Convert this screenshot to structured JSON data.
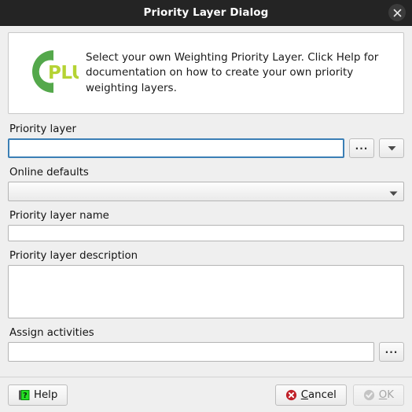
{
  "window": {
    "title": "Priority Layer Dialog",
    "close_icon": "close-icon"
  },
  "info": {
    "logo_icon": "cplus-logo-icon",
    "logo_text": "PLUS",
    "message": "Select your own Weighting Priority Layer. Click Help for documentation on how to create your own priority weighting layers.",
    "logo_color_c": "#4da css",
    "colors": {
      "logo_ring": "#54a84b",
      "logo_word": "#b5d334"
    }
  },
  "form": {
    "priority_layer": {
      "label": "Priority layer",
      "value": "",
      "placeholder": "",
      "browse_button": "...",
      "dropdown_icon": "chevron-down-icon"
    },
    "online_defaults": {
      "label": "Online defaults",
      "selected": "",
      "dropdown_icon": "chevron-down-icon"
    },
    "priority_layer_name": {
      "label": "Priority layer name",
      "value": "",
      "placeholder": ""
    },
    "priority_layer_description": {
      "label": "Priority layer description",
      "value": "",
      "placeholder": ""
    },
    "assign_activities": {
      "label": "Assign activities",
      "value": "",
      "placeholder": "",
      "browse_button": "..."
    }
  },
  "buttons": {
    "help": {
      "label": "Help",
      "icon": "help-book-icon",
      "enabled": true
    },
    "cancel": {
      "label_prefix": "C",
      "label_rest": "ancel",
      "icon": "cancel-circle-icon",
      "icon_color": "#c0222a",
      "enabled": true
    },
    "ok": {
      "label_prefix": "O",
      "label_rest": "K",
      "icon": "ok-check-icon",
      "icon_color": "#bdbdbd",
      "enabled": false
    }
  },
  "theme": {
    "titlebar_bg": "#242424",
    "dialog_bg": "#efefef",
    "focus_border": "#3b7fb5",
    "field_border": "#b4b4b4"
  }
}
